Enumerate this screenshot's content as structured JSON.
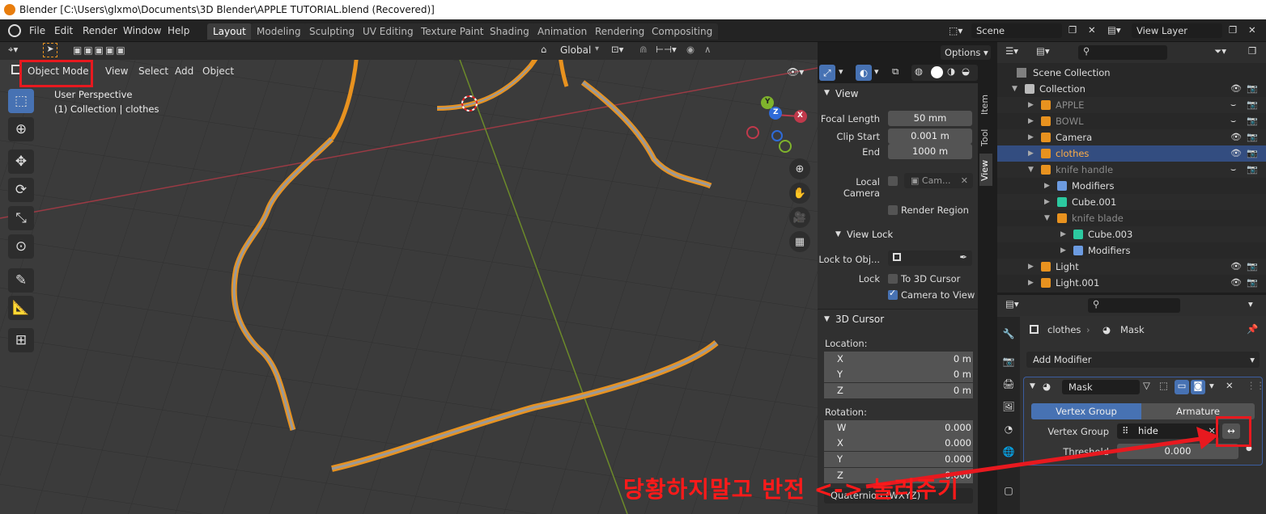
{
  "window": {
    "title": "Blender [C:\\Users\\glxmo\\Documents\\3D Blender\\APPLE TUTORIAL.blend (Recovered)]"
  },
  "menu": [
    "File",
    "Edit",
    "Render",
    "Window",
    "Help"
  ],
  "workspaces": [
    "Layout",
    "Modeling",
    "Sculpting",
    "UV Editing",
    "Texture Paint",
    "Shading",
    "Animation",
    "Rendering",
    "Compositing"
  ],
  "topright": {
    "scene": "Scene",
    "view_layer": "View Layer"
  },
  "toolheader": {
    "transform_orientation": "Global",
    "options": "Options"
  },
  "viewport_header": {
    "mode": "Object Mode",
    "items": [
      "View",
      "Select",
      "Add",
      "Object"
    ]
  },
  "viewport_info": {
    "perspective": "User Perspective",
    "collection": "(1) Collection | clothes"
  },
  "gizmo": {
    "x": "X",
    "y": "Y",
    "z": "Z"
  },
  "npanel": {
    "tabs": [
      "Item",
      "Tool",
      "View"
    ],
    "view_title": "View",
    "focal_length_label": "Focal Length",
    "focal_length": "50 mm",
    "clip_start_label": "Clip Start",
    "clip_start": "0.001 m",
    "clip_end_label": "End",
    "clip_end": "1000 m",
    "local_camera_label": "Local Camera",
    "local_camera_value": "Cam...",
    "render_region": "Render Region",
    "view_lock_title": "View Lock",
    "lock_to_obj_label": "Lock to Obj...",
    "lock_label": "Lock",
    "to_3d_cursor": "To 3D Cursor",
    "camera_to_view": "Camera to View",
    "cursor_title": "3D Cursor",
    "location_label": "Location:",
    "location": [
      {
        "axis": "X",
        "value": "0 m"
      },
      {
        "axis": "Y",
        "value": "0 m"
      },
      {
        "axis": "Z",
        "value": "0 m"
      }
    ],
    "rotation_label": "Rotation:",
    "rotation": [
      {
        "axis": "W",
        "value": "0.000"
      },
      {
        "axis": "X",
        "value": "0.000"
      },
      {
        "axis": "Y",
        "value": "0.000"
      },
      {
        "axis": "Z",
        "value": "0.000"
      }
    ],
    "rotation_mode": "Quaternion (WXYZ)"
  },
  "outliner": {
    "scene_collection": "Scene Collection",
    "rows": [
      {
        "name": "Collection",
        "indent": 0
      },
      {
        "name": "APPLE",
        "indent": 1
      },
      {
        "name": "BOWL",
        "indent": 1
      },
      {
        "name": "Camera",
        "indent": 1
      },
      {
        "name": "clothes",
        "indent": 1
      },
      {
        "name": "knife handle",
        "indent": 1
      },
      {
        "name": "Modifiers",
        "indent": 2
      },
      {
        "name": "Cube.001",
        "indent": 2
      },
      {
        "name": "knife blade",
        "indent": 2
      },
      {
        "name": "Cube.003",
        "indent": 3
      },
      {
        "name": "Modifiers",
        "indent": 3
      },
      {
        "name": "Light",
        "indent": 1
      },
      {
        "name": "Light.001",
        "indent": 1
      }
    ]
  },
  "properties": {
    "object": "clothes",
    "modifier_context": "Mask",
    "add_modifier": "Add Modifier",
    "modifier_name": "Mask",
    "tab_vertex_group": "Vertex Group",
    "tab_armature": "Armature",
    "vertex_group_label": "Vertex Group",
    "vertex_group_value": "hide",
    "threshold_label": "Threshold",
    "threshold_value": "0.000"
  },
  "annotation": {
    "text": "당황하지말고 반전 <-> 눌러주기",
    "color": "#ff1a1a"
  },
  "colors": {
    "accent": "#4772b3",
    "selection": "#e8921f",
    "highlight": "#e8191f"
  }
}
